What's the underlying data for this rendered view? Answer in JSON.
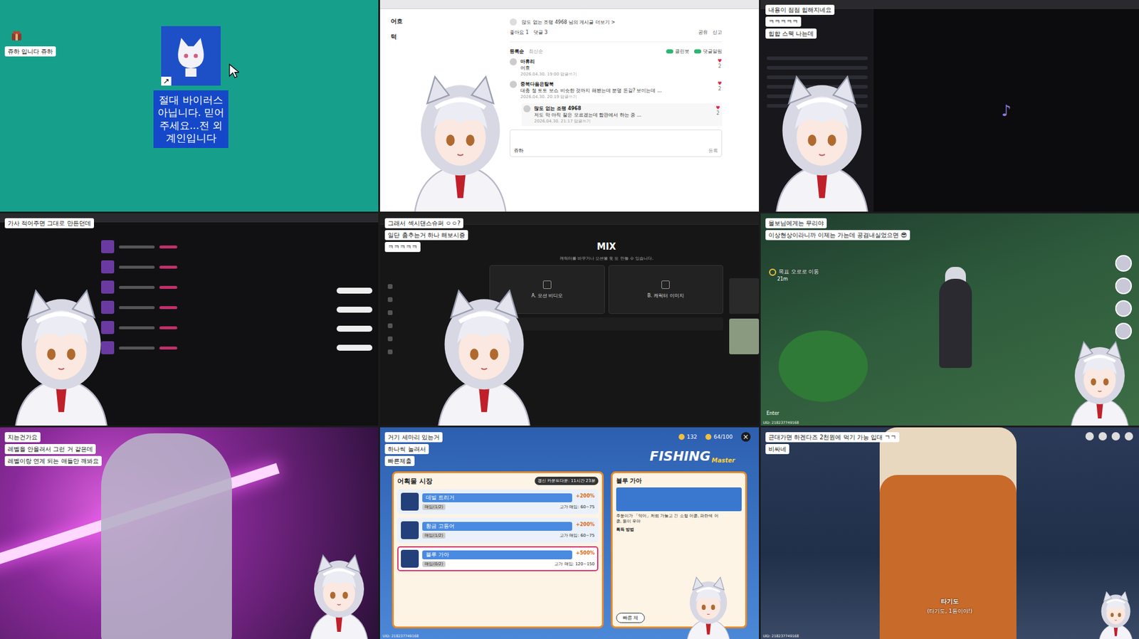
{
  "tiles": [
    {
      "kind": "desktop",
      "captions": [
        "쥬하 입니다 쥬하"
      ],
      "shortcut_arrow": "↗",
      "card_text": "절대 바이러스 아닙니다. 믿어 주세요...전 외계인입니다"
    },
    {
      "kind": "forum",
      "captions": [],
      "side_labels": [
        "어흐",
        "턱"
      ],
      "author_line": "많도 없는 조랭 4968 님의 게시글 더보기 >",
      "stats": [
        "좋아요 1",
        "댓글 3"
      ],
      "actions": [
        "공유",
        "신고"
      ],
      "sort": [
        {
          "label": "등록순",
          "selected": true
        },
        {
          "label": "최신순",
          "selected": false
        }
      ],
      "toggles": [
        "클린봇",
        "댓글알림"
      ],
      "comments": [
        {
          "name": "마휴리",
          "text": "어흐",
          "meta": "2026.04.30. 19:00 답글쓰기",
          "likes": "2",
          "reply": false
        },
        {
          "name": "중복다음은탈북",
          "text": "대충 청 토토 보스 비슷한 것까지 해봤는데 분명 돈길? 보이는데 ...",
          "meta": "2026.04.30. 20:19 답글쓰기",
          "likes": "2",
          "reply": false
        },
        {
          "name": "많도 없는 조랭 4968",
          "text": "저도 막 아직 잘은 모르겠는데 합판에서 하는 중 ...",
          "meta": "2026.04.30. 21:17 답글쓰기",
          "likes": "2",
          "reply": true
        }
      ],
      "input_label": "쥬하",
      "submit": "등록"
    },
    {
      "kind": "dark-app",
      "captions": [
        "내용이 점점 힙해지네요",
        "ㅋㅋㅋㅋㅋ",
        "힙합 스웩 나는데"
      ],
      "note": "♪"
    },
    {
      "kind": "music",
      "captions": [
        "가사 적어주면 그대로 만든던데"
      ]
    },
    {
      "kind": "mix",
      "captions": [
        "그래서 섹시댄스슈퍼 ㅇㅇ?",
        "일단 춤추는거 하나 해보시죵",
        "ㅋㅋㅋㅋㅋ"
      ],
      "title": "MIX",
      "subtitle": "캐릭터를 바꾸거나 모션을 옷 또 만들 수 있습니다.",
      "cards": [
        "A. 모션 비디오",
        "B. 캐릭터 이미지"
      ]
    },
    {
      "kind": "game-forest",
      "captions": [
        "몰보님에게는 무리야",
        "이상현상이라니까 이제는 가는데 공겸내실었으면 😎"
      ],
      "quest": "목표 오로로 이동",
      "distance": "21m",
      "chat": "Enter",
      "uid": "UID: 218237749168"
    },
    {
      "kind": "cutscene",
      "captions": [
        "지는건가요",
        "레벨을 안올려서 그런 거 같은데",
        "레벨이랑 연계 되는 애들만 깨봐요"
      ]
    },
    {
      "kind": "fishing",
      "captions": [
        "거기 세마리 있는거",
        "하나씩 놀려서",
        "빠른제출"
      ],
      "logo": "FISHING",
      "logo_sub": "Master",
      "currency": [
        "132",
        "64/100"
      ],
      "close": "×",
      "market_title": "어획물 시장",
      "countdown": "갱신 카운트다운: 11시간 23분",
      "fish": [
        {
          "name": "데빌 트리거",
          "bonus": "+200%",
          "count": "매입(1/2)",
          "price": "고가 매입: 60~75",
          "selected": false
        },
        {
          "name": "황금 고등어",
          "bonus": "+200%",
          "count": "매입(1/2)",
          "price": "고가 매입: 60~75",
          "selected": false
        },
        {
          "name": "블루 가아",
          "bonus": "+500%",
          "count": "매입(0/2)",
          "price": "고가 매입: 120~150",
          "selected": true
        }
      ],
      "detail_title": "블루 가아",
      "detail_text": "주둥이가 「악어」처럼 가늘고 긴 소형 어종, 파란색 어종, 등이 우아",
      "detail_label": "획득 방법",
      "detail_button": "빠른 제",
      "uid": "UID: 218237749168"
    },
    {
      "kind": "game-city",
      "captions": [
        "근대가면 하겐다즈 2천원에 먹기 가능 입대 ㄱㄱ",
        "비싸네"
      ],
      "speaker": "타기도",
      "line": "(타기도, 1등이야!)",
      "uid": "UID: 218237749168"
    }
  ]
}
